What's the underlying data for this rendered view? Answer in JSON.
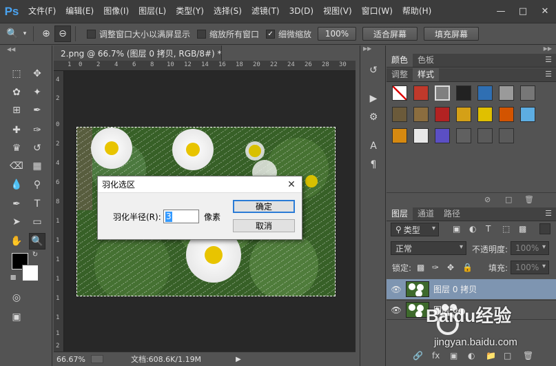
{
  "app": {
    "logo": "Ps",
    "menu": [
      "文件(F)",
      "编辑(E)",
      "图像(I)",
      "图层(L)",
      "类型(Y)",
      "选择(S)",
      "滤镜(T)",
      "3D(D)",
      "视图(V)",
      "窗口(W)",
      "帮助(H)"
    ],
    "window_controls": [
      "minimize-icon",
      "restore-icon",
      "close-icon"
    ]
  },
  "options": {
    "checkbox_fit_window": "调整窗口大小以满屏显示",
    "checkbox_zoom_all": "缩放所有窗口",
    "checkbox_scrubby": "细微缩放",
    "scrubby_checked": true,
    "btn_100": "100%",
    "btn_fit_screen": "适合屏幕",
    "btn_fill_screen": "填充屏幕"
  },
  "document": {
    "tab_title": "2.png @ 66.7% (图层 0 拷贝, RGB/8#) *",
    "ruler_top": [
      "1",
      "0",
      "2",
      "4",
      "6",
      "8",
      "10",
      "12",
      "14",
      "16",
      "18",
      "20",
      "22",
      "24",
      "26",
      "28",
      "30"
    ],
    "ruler_left": [
      "4",
      "2",
      "0",
      "2",
      "4",
      "6",
      "8",
      "1",
      "1",
      "1",
      "1",
      "1",
      "1",
      "1",
      "2"
    ],
    "status_zoom": "66.67%",
    "status_doc": "文档:608.6K/1.19M"
  },
  "dialog": {
    "title": "羽化选区",
    "radius_label": "羽化半径(R):",
    "radius_value": "3",
    "unit": "像素",
    "ok": "确定",
    "cancel": "取消"
  },
  "panels": {
    "tabs_top": [
      "颜色",
      "色板"
    ],
    "tabs_mid": [
      "调整",
      "样式"
    ],
    "style_swatch_colors": [
      "#ffffff",
      "#c0392b",
      "#808080",
      "#222222",
      "#2f6fb3",
      "#9a9a9a",
      "#777777",
      "#6b5a3a",
      "#8b6d3f",
      "#b22222",
      "#d4a017",
      "#e0c000",
      "#d35400",
      "#5dade2",
      "#d68910",
      "#e8e8e8",
      "#5b4fc4",
      "#606060",
      "#5a5a5a",
      "#5a5a5a"
    ],
    "tabs_layers": [
      "图层",
      "通道",
      "路径"
    ],
    "filter_kind": "类型",
    "blend_mode": "正常",
    "opacity_label": "不透明度:",
    "opacity_value": "100%",
    "lock_label": "锁定:",
    "fill_label": "填充:",
    "fill_value": "100%",
    "layers": [
      {
        "name": "图层 0 拷贝",
        "selected": true
      },
      {
        "name": "图层 0",
        "selected": false
      }
    ]
  },
  "watermark": {
    "brand": "Baidu经验",
    "url": "jingyan.baidu.com"
  },
  "colors": {
    "ui_dark": "#535353",
    "menubar": "#3c3c3c",
    "accent_layer_selected": "#7e95b1",
    "ps_blue": "#4aa3f0"
  }
}
